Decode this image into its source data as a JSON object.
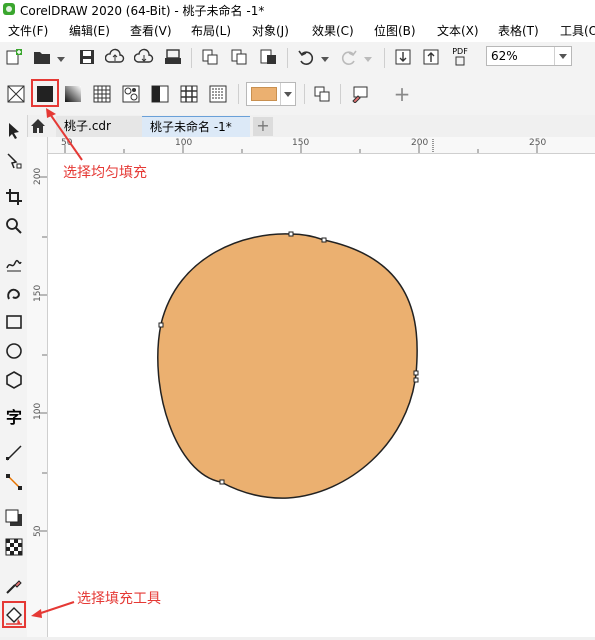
{
  "window": {
    "title": "CorelDRAW 2020 (64-Bit) - 桃子未命名 -1*"
  },
  "menu": [
    {
      "label": "文件(F)"
    },
    {
      "label": "编辑(E)"
    },
    {
      "label": "查看(V)"
    },
    {
      "label": "布局(L)"
    },
    {
      "label": "对象(J)"
    },
    {
      "label": "效果(C)"
    },
    {
      "label": "位图(B)"
    },
    {
      "label": "文本(X)"
    },
    {
      "label": "表格(T)"
    },
    {
      "label": "工具(O"
    }
  ],
  "toolbar": {
    "zoom": "62%",
    "pdf_label": "PDF"
  },
  "property_bar": {
    "fill_color": "#EBB070"
  },
  "tabs": [
    {
      "label": "桃子.cdr",
      "active": false
    },
    {
      "label": "桃子未命名 -1*",
      "active": true
    }
  ],
  "ruler": {
    "h_labels": [
      "50",
      "100",
      "150",
      "200",
      "250"
    ],
    "v_labels": [
      "200",
      "150",
      "100",
      "50"
    ]
  },
  "shape": {
    "fill": "#EBB070",
    "stroke": "#222222"
  },
  "annotations": {
    "uniform_fill": "选择均匀填充",
    "fill_tool": "选择填充工具"
  },
  "colors": {
    "accent_red": "#E53935",
    "peach": "#EBB070"
  }
}
